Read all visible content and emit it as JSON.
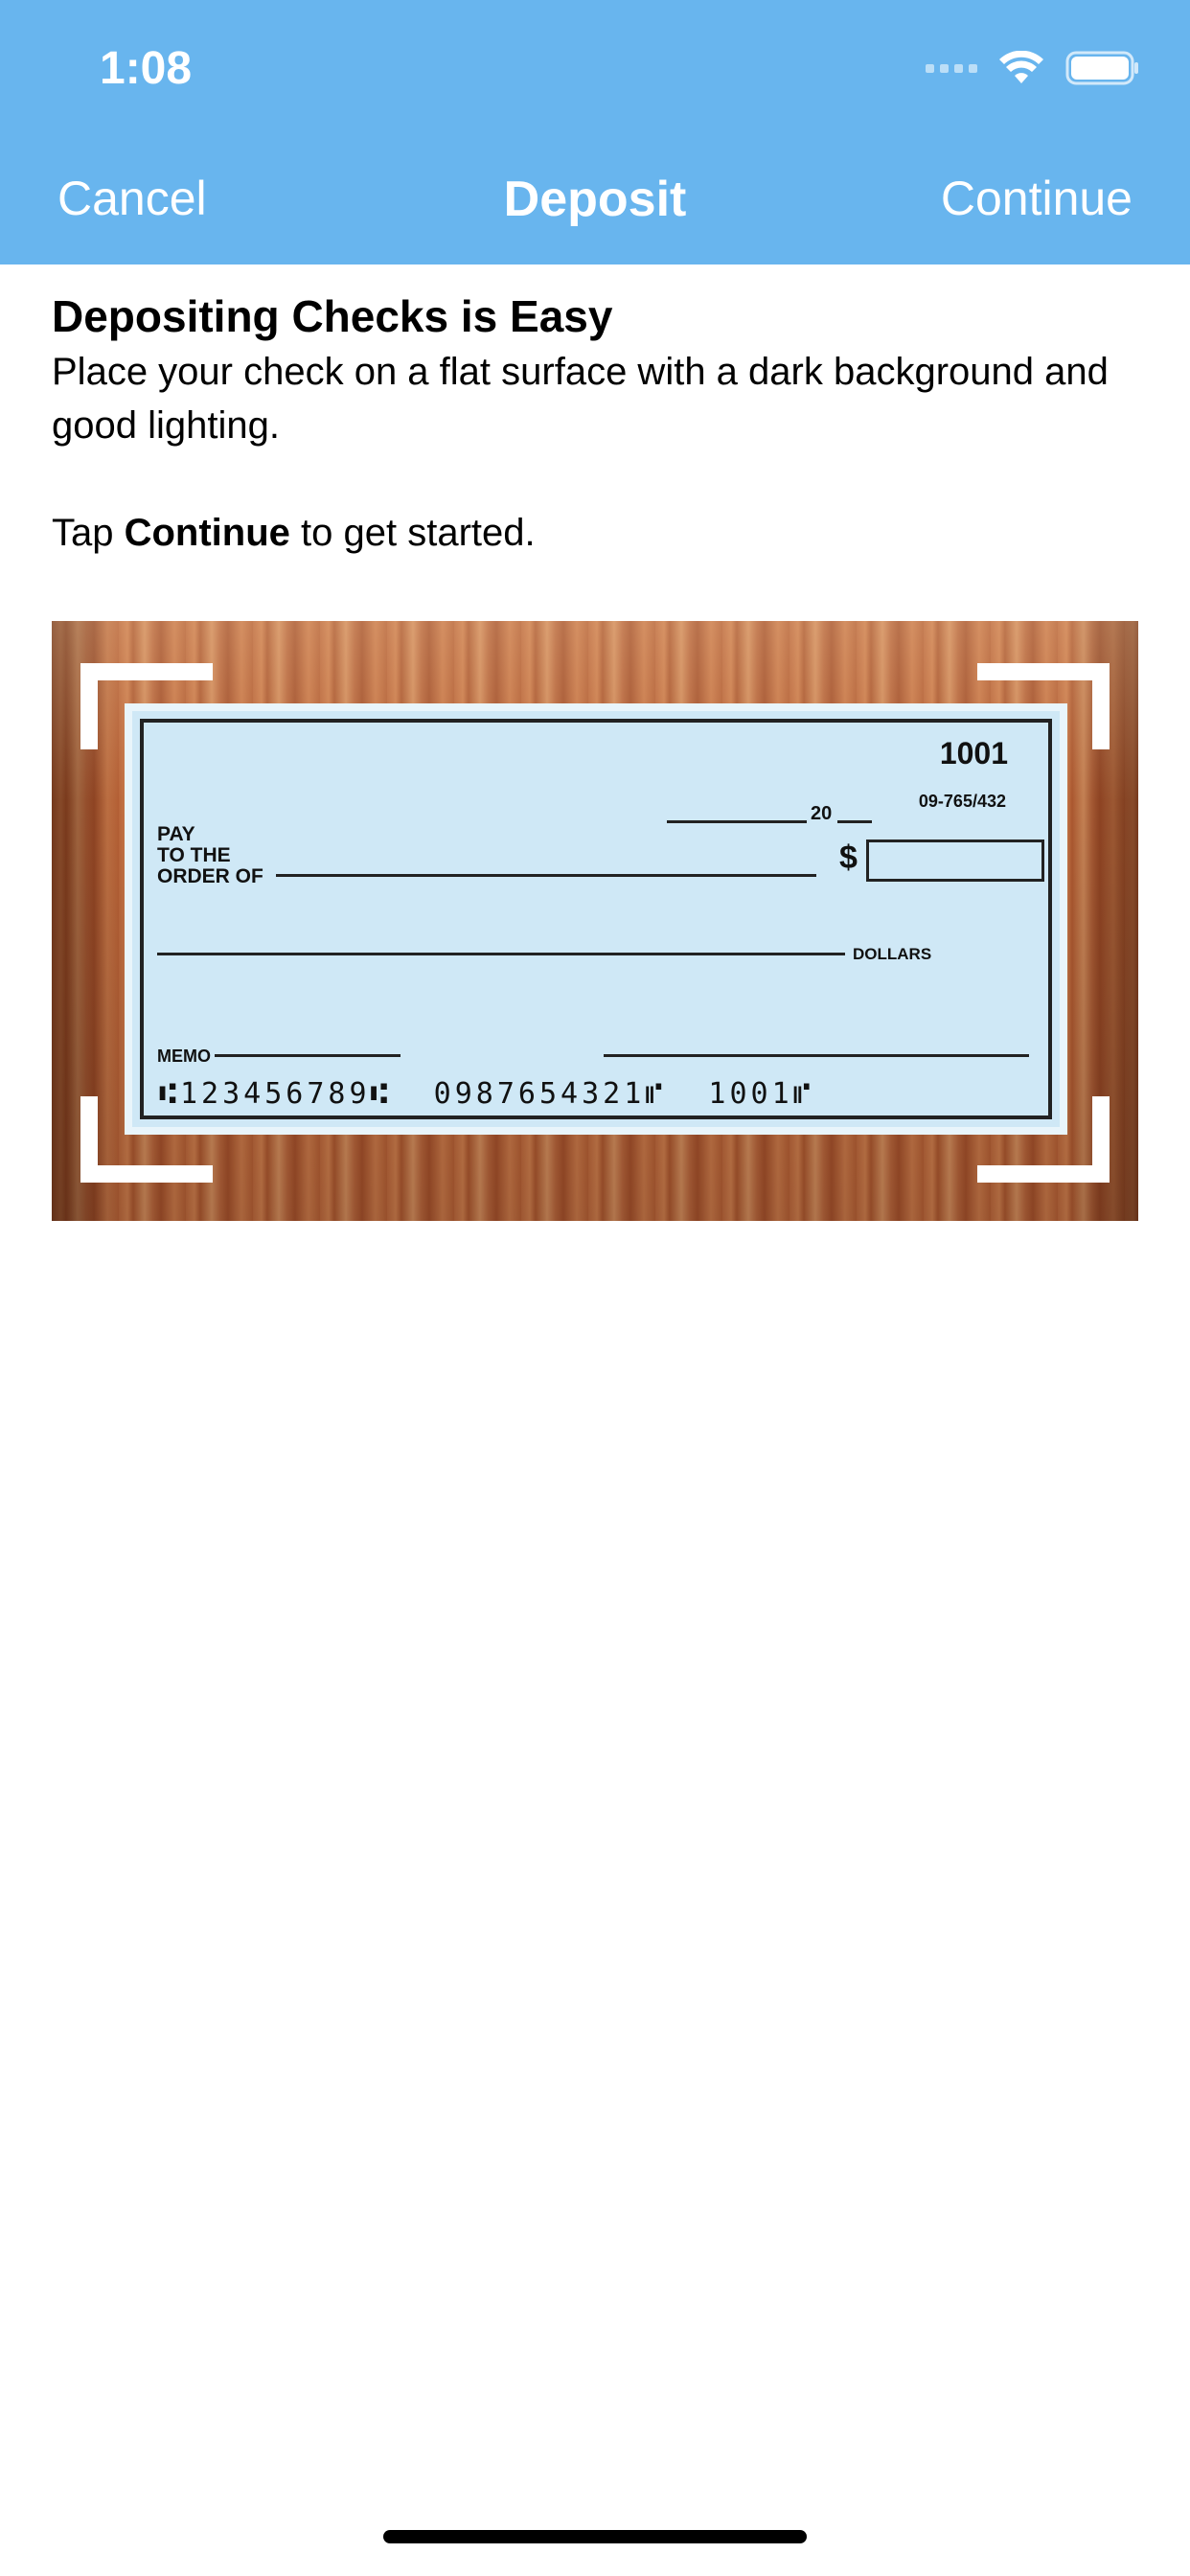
{
  "status": {
    "time": "1:08"
  },
  "nav": {
    "cancel": "Cancel",
    "title": "Deposit",
    "continue": "Continue"
  },
  "content": {
    "heading": "Depositing Checks is Easy",
    "instruction": "Place your check on a flat surface with a dark background and good lighting.",
    "tap_prefix": "Tap ",
    "tap_bold": "Continue",
    "tap_suffix": " to get started."
  },
  "check": {
    "number": "1001",
    "routing_fraction": "09-765/432",
    "date_year_prefix": "20",
    "pay_label_1": "PAY",
    "pay_label_2": "TO THE",
    "pay_label_3": "ORDER OF",
    "dollar_sign": "$",
    "dollars_label": "DOLLARS",
    "memo_label": "MEMO",
    "micr_line": "⑆123456789⑆  0987654321⑈  1001⑈"
  },
  "colors": {
    "header_bg": "#68b5ee",
    "check_bg": "#cfe8f6"
  }
}
